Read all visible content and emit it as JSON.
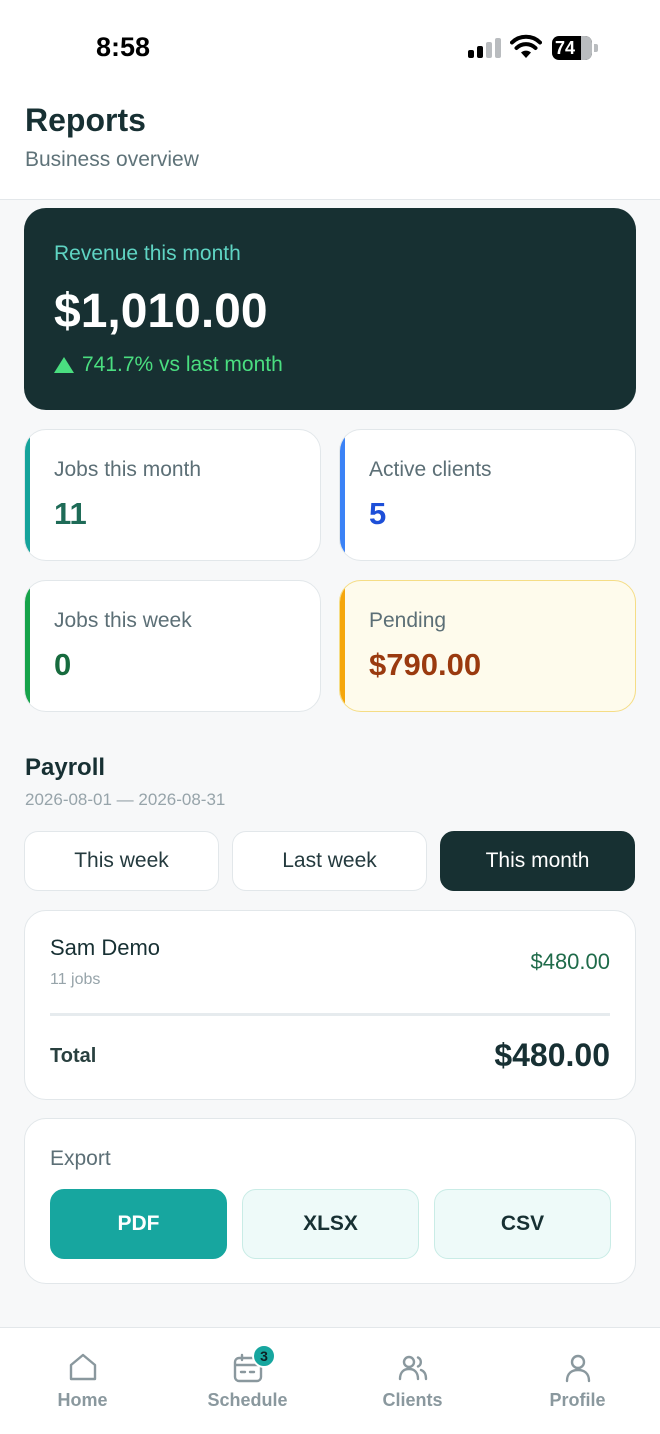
{
  "status_bar": {
    "time": "8:58",
    "battery": "74"
  },
  "header": {
    "title": "Reports",
    "subtitle": "Business overview"
  },
  "revenue": {
    "label": "Revenue this month",
    "amount": "$1,010.00",
    "change": "741.7% vs last month"
  },
  "stats": [
    {
      "label": "Jobs this month",
      "value": "11",
      "accent": "#15a39b",
      "value_color": "#1e6b57"
    },
    {
      "label": "Active clients",
      "value": "5",
      "accent": "#3b82f6",
      "value_color": "#1d4fd8"
    },
    {
      "label": "Jobs this week",
      "value": "0",
      "accent": "#16a34a",
      "value_color": "#176b3e"
    },
    {
      "label": "Pending",
      "value": "$790.00",
      "accent": "#f5a60b",
      "value_color": "#9a3a0f"
    }
  ],
  "payroll": {
    "title": "Payroll",
    "range": "2026-08-01 — 2026-08-31",
    "periods": [
      "This week",
      "Last week",
      "This month"
    ],
    "active_period": "This month",
    "entries": [
      {
        "name": "Sam Demo",
        "jobs": "11 jobs",
        "amount": "$480.00"
      }
    ],
    "total_label": "Total",
    "total_amount": "$480.00"
  },
  "export": {
    "label": "Export",
    "formats": [
      "PDF",
      "XLSX",
      "CSV"
    ],
    "primary": "PDF"
  },
  "tabs": [
    {
      "label": "Home",
      "icon": "home-icon"
    },
    {
      "label": "Schedule",
      "icon": "calendar-icon",
      "badge": "3"
    },
    {
      "label": "Clients",
      "icon": "users-icon"
    },
    {
      "label": "Profile",
      "icon": "user-icon"
    }
  ]
}
